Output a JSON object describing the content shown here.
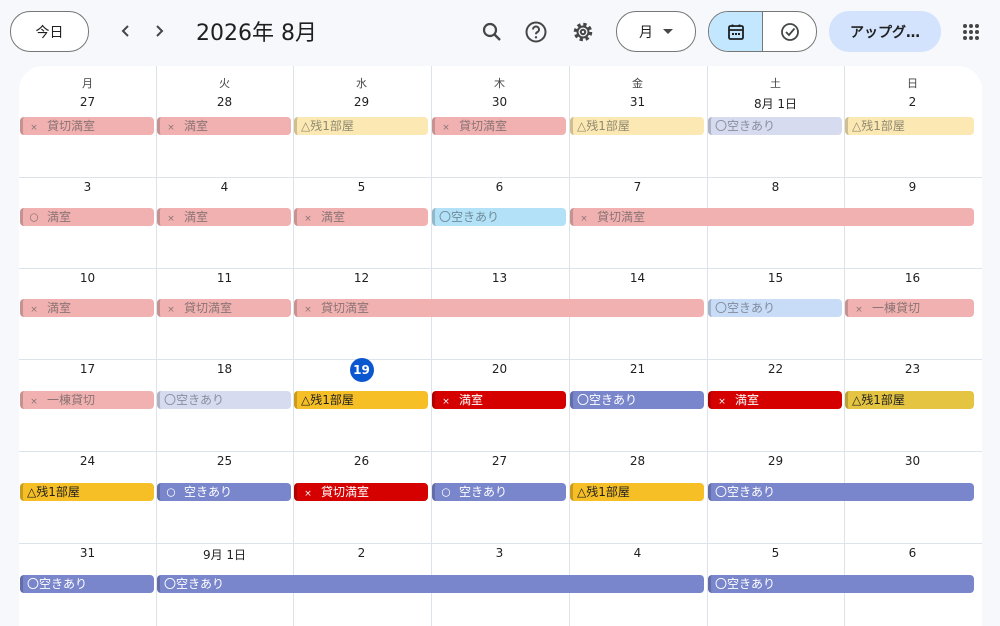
{
  "header": {
    "today_label": "今日",
    "prev_icon": "chevron-left-icon",
    "next_icon": "chevron-right-icon",
    "title": "2026年 8月",
    "view_label": "月",
    "upgrade_label": "アップグ…"
  },
  "weekdays": [
    "月",
    "火",
    "水",
    "木",
    "金",
    "土",
    "日"
  ],
  "weeks": [
    [
      "27",
      "28",
      "29",
      "30",
      "31",
      "8月 1日",
      "2"
    ],
    [
      "3",
      "4",
      "5",
      "6",
      "7",
      "8",
      "9"
    ],
    [
      "10",
      "11",
      "12",
      "13",
      "14",
      "15",
      "16"
    ],
    [
      "17",
      "18",
      "19",
      "20",
      "21",
      "22",
      "23"
    ],
    [
      "24",
      "25",
      "26",
      "27",
      "28",
      "29",
      "30"
    ],
    [
      "31",
      "9月 1日",
      "2",
      "3",
      "4",
      "5",
      "6"
    ]
  ],
  "today": "19",
  "events": [
    {
      "week": 0,
      "start": 0,
      "span": 1,
      "mark": "×",
      "text": "貸切満室",
      "style": "past-red"
    },
    {
      "week": 0,
      "start": 1,
      "span": 1,
      "mark": "×",
      "text": "満室",
      "style": "past-red"
    },
    {
      "week": 0,
      "start": 2,
      "span": 1,
      "mark": "",
      "text": "△残1部屋",
      "style": "past-yel"
    },
    {
      "week": 0,
      "start": 3,
      "span": 1,
      "mark": "×",
      "text": "貸切満室",
      "style": "past-red"
    },
    {
      "week": 0,
      "start": 4,
      "span": 1,
      "mark": "",
      "text": "△残1部屋",
      "style": "past-yel"
    },
    {
      "week": 0,
      "start": 5,
      "span": 1,
      "mark": "",
      "text": "〇空きあり",
      "style": "past-lav"
    },
    {
      "week": 0,
      "start": 6,
      "span": 1,
      "mark": "",
      "text": "△残1部屋",
      "style": "past-yel"
    },
    {
      "week": 1,
      "start": 0,
      "span": 1,
      "mark": "〇",
      "text": "満室",
      "style": "past-red"
    },
    {
      "week": 1,
      "start": 1,
      "span": 1,
      "mark": "×",
      "text": "満室",
      "style": "past-red"
    },
    {
      "week": 1,
      "start": 2,
      "span": 1,
      "mark": "×",
      "text": "満室",
      "style": "past-red"
    },
    {
      "week": 1,
      "start": 3,
      "span": 1,
      "mark": "",
      "text": "〇空きあり",
      "style": "past-blu"
    },
    {
      "week": 1,
      "start": 4,
      "span": 3,
      "mark": "×",
      "text": "貸切満室",
      "style": "past-red"
    },
    {
      "week": 2,
      "start": 0,
      "span": 1,
      "mark": "×",
      "text": "満室",
      "style": "past-red"
    },
    {
      "week": 2,
      "start": 1,
      "span": 1,
      "mark": "×",
      "text": "貸切満室",
      "style": "past-red"
    },
    {
      "week": 2,
      "start": 2,
      "span": 3,
      "mark": "×",
      "text": "貸切満室",
      "style": "past-red"
    },
    {
      "week": 2,
      "start": 5,
      "span": 1,
      "mark": "",
      "text": "〇空きあり",
      "style": "past-sky"
    },
    {
      "week": 2,
      "start": 6,
      "span": 1,
      "mark": "×",
      "text": "一棟貸切",
      "style": "past-red"
    },
    {
      "week": 3,
      "start": 0,
      "span": 1,
      "mark": "×",
      "text": "一棟貸切",
      "style": "past-red"
    },
    {
      "week": 3,
      "start": 1,
      "span": 1,
      "mark": "",
      "text": "〇空きあり",
      "style": "past-lav"
    },
    {
      "week": 3,
      "start": 2,
      "span": 1,
      "mark": "",
      "text": "△残1部屋",
      "style": "cur-yel"
    },
    {
      "week": 3,
      "start": 3,
      "span": 1,
      "mark": "×",
      "text": "満室",
      "style": "cur-red"
    },
    {
      "week": 3,
      "start": 4,
      "span": 1,
      "mark": "",
      "text": "〇空きあり",
      "style": "cur-lav"
    },
    {
      "week": 3,
      "start": 5,
      "span": 1,
      "mark": "×",
      "text": "満室",
      "style": "cur-red"
    },
    {
      "week": 3,
      "start": 6,
      "span": 1,
      "mark": "",
      "text": "△残1部屋",
      "style": "cur-gold"
    },
    {
      "week": 4,
      "start": 0,
      "span": 1,
      "mark": "",
      "text": "△残1部屋",
      "style": "cur-yel"
    },
    {
      "week": 4,
      "start": 1,
      "span": 1,
      "mark": "〇",
      "text": "空きあり",
      "style": "cur-lav"
    },
    {
      "week": 4,
      "start": 2,
      "span": 1,
      "mark": "×",
      "text": "貸切満室",
      "style": "cur-red"
    },
    {
      "week": 4,
      "start": 3,
      "span": 1,
      "mark": "〇",
      "text": "空きあり",
      "style": "cur-lav"
    },
    {
      "week": 4,
      "start": 4,
      "span": 1,
      "mark": "",
      "text": "△残1部屋",
      "style": "cur-yel"
    },
    {
      "week": 4,
      "start": 5,
      "span": 2,
      "mark": "",
      "text": "〇空きあり",
      "style": "cur-lav"
    },
    {
      "week": 5,
      "start": 0,
      "span": 1,
      "mark": "",
      "text": "〇空きあり",
      "style": "cur-lav"
    },
    {
      "week": 5,
      "start": 1,
      "span": 4,
      "mark": "",
      "text": "〇空きあり",
      "style": "cur-lav"
    },
    {
      "week": 5,
      "start": 5,
      "span": 2,
      "mark": "",
      "text": "〇空きあり",
      "style": "cur-lav"
    }
  ]
}
